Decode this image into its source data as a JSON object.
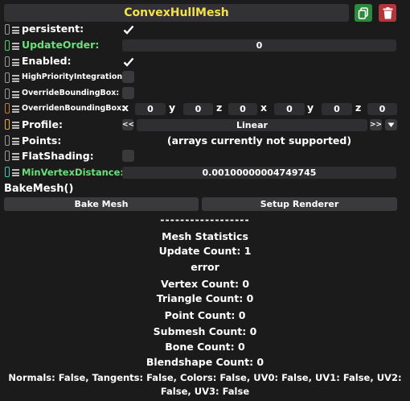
{
  "header": {
    "title": "ConvexHullMesh",
    "copy_icon": "copy-icon",
    "delete_icon": "trash-icon",
    "copy_color": "#2b8a3c",
    "delete_color": "#b3353a",
    "title_color": "#f4e04a"
  },
  "rows": {
    "persistent": {
      "label": "persistent:",
      "checked": true
    },
    "update_order": {
      "label": "UpdateOrder:",
      "value": "0"
    },
    "enabled": {
      "label": "Enabled:",
      "checked": true
    },
    "high_priority": {
      "label": "HighPriorityIntegration:",
      "checked": false
    },
    "override_bbox": {
      "label": "OverrideBoundingBox:",
      "checked": false
    },
    "overriden_bbox": {
      "label": "OverridenBoundingBox:",
      "axes": [
        "x",
        "y",
        "z",
        "x",
        "y",
        "z"
      ],
      "values": [
        "0",
        "0",
        "0",
        "0",
        "0",
        "0"
      ]
    },
    "profile": {
      "label": "Profile:",
      "prev": "<<",
      "value": "Linear",
      "next": ">>",
      "dropdown_icon": "triangle-down-icon"
    },
    "points": {
      "label": "Points:",
      "note": "(arrays currently not supported)"
    },
    "flat_shading": {
      "label": "FlatShading:",
      "checked": false
    },
    "min_vertex_distance": {
      "label": "MinVertexDistance:",
      "value": "0.00100000004749745"
    }
  },
  "method": {
    "label": "BakeMesh()"
  },
  "buttons": {
    "bake": "Bake Mesh",
    "setup": "Setup Renderer"
  },
  "stats": {
    "divider": "------------------",
    "title": "Mesh Statistics",
    "update_count": "Update Count: 1",
    "error": "error",
    "vertex_count": "Vertex Count: 0",
    "triangle_count": "Triangle Count: 0",
    "point_count": "Point Count: 0",
    "submesh_count": "Submesh Count: 0",
    "bone_count": "Bone Count: 0",
    "blendshape_count": "Blendshape Count: 0",
    "attributes_line1": "Normals: False, Tangents: False, Colors: False, UV0: False, UV1: False, UV2:",
    "attributes_line2": "False, UV3: False"
  }
}
